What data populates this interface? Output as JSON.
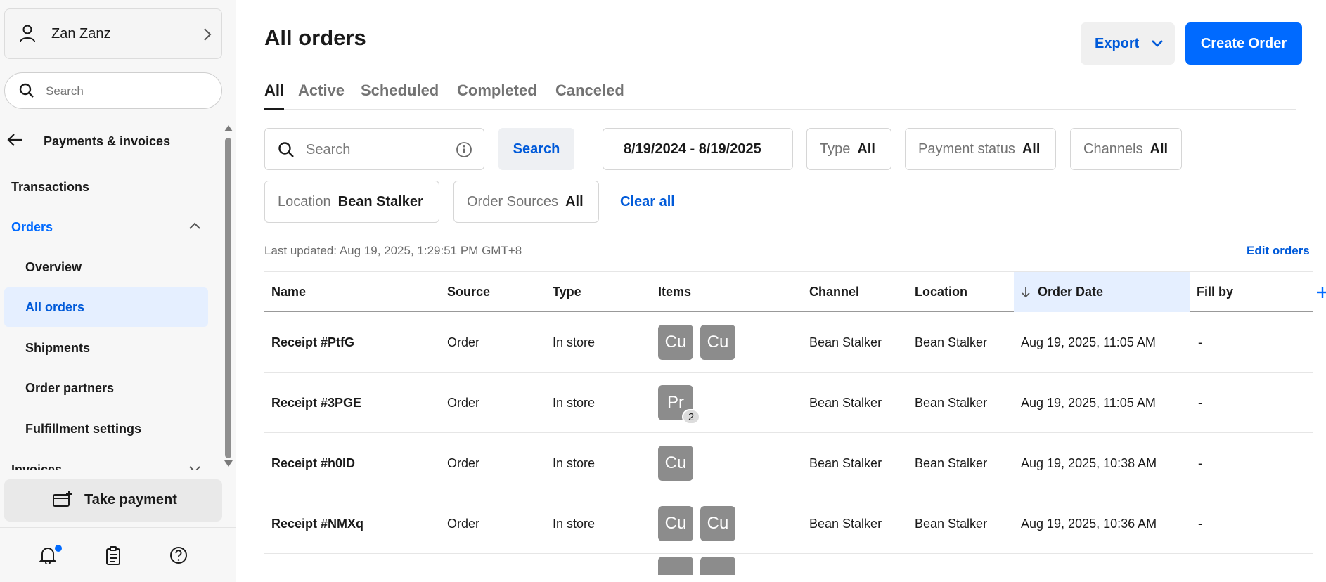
{
  "user": {
    "name": "Zan Zanz"
  },
  "sidebar": {
    "search_placeholder": "Search",
    "section_title": "Payments & invoices",
    "items": [
      {
        "label": "Transactions"
      },
      {
        "label": "Orders"
      },
      {
        "label": "Overview"
      },
      {
        "label": "All orders"
      },
      {
        "label": "Shipments"
      },
      {
        "label": "Order partners"
      },
      {
        "label": "Fulfillment settings"
      },
      {
        "label": "Invoices"
      }
    ],
    "take_payment": "Take payment"
  },
  "header": {
    "title": "All orders",
    "export_label": "Export",
    "create_label": "Create Order"
  },
  "tabs": [
    {
      "label": "All"
    },
    {
      "label": "Active"
    },
    {
      "label": "Scheduled"
    },
    {
      "label": "Completed"
    },
    {
      "label": "Canceled"
    }
  ],
  "filters": {
    "search_placeholder": "Search",
    "search_button": "Search",
    "date_range": "8/19/2024 - 8/19/2025",
    "type": {
      "label": "Type",
      "value": "All"
    },
    "payment_status": {
      "label": "Payment status",
      "value": "All"
    },
    "channels": {
      "label": "Channels",
      "value": "All"
    },
    "location": {
      "label": "Location",
      "value": "Bean Stalker"
    },
    "order_sources": {
      "label": "Order Sources",
      "value": "All"
    },
    "clear_all": "Clear all"
  },
  "last_updated": "Last updated: Aug 19, 2025, 1:29:51 PM GMT+8",
  "edit_orders": "Edit orders",
  "table": {
    "columns": [
      "Name",
      "Source",
      "Type",
      "Items",
      "Channel",
      "Location",
      "Order Date",
      "Fill by"
    ],
    "rows": [
      {
        "name": "Receipt #PtfG",
        "source": "Order",
        "type": "In store",
        "items": [
          "Cu",
          "Cu"
        ],
        "channel": "Bean Stalker",
        "location": "Bean Stalker",
        "date": "Aug 19, 2025, 11:05 AM",
        "fill_by": "-"
      },
      {
        "name": "Receipt #3PGE",
        "source": "Order",
        "type": "In store",
        "items": [
          "Pr"
        ],
        "item_qty": "2",
        "channel": "Bean Stalker",
        "location": "Bean Stalker",
        "date": "Aug 19, 2025, 11:05 AM",
        "fill_by": "-"
      },
      {
        "name": "Receipt #h0ID",
        "source": "Order",
        "type": "In store",
        "items": [
          "Cu"
        ],
        "channel": "Bean Stalker",
        "location": "Bean Stalker",
        "date": "Aug 19, 2025, 10:38 AM",
        "fill_by": "-"
      },
      {
        "name": "Receipt #NMXq",
        "source": "Order",
        "type": "In store",
        "items": [
          "Cu",
          "Cu"
        ],
        "channel": "Bean Stalker",
        "location": "Bean Stalker",
        "date": "Aug 19, 2025, 10:36 AM",
        "fill_by": "-"
      }
    ]
  },
  "colors": {
    "accent": "#006aff",
    "selected_bg": "#e5efff",
    "thumb": "#8c8c8c"
  }
}
